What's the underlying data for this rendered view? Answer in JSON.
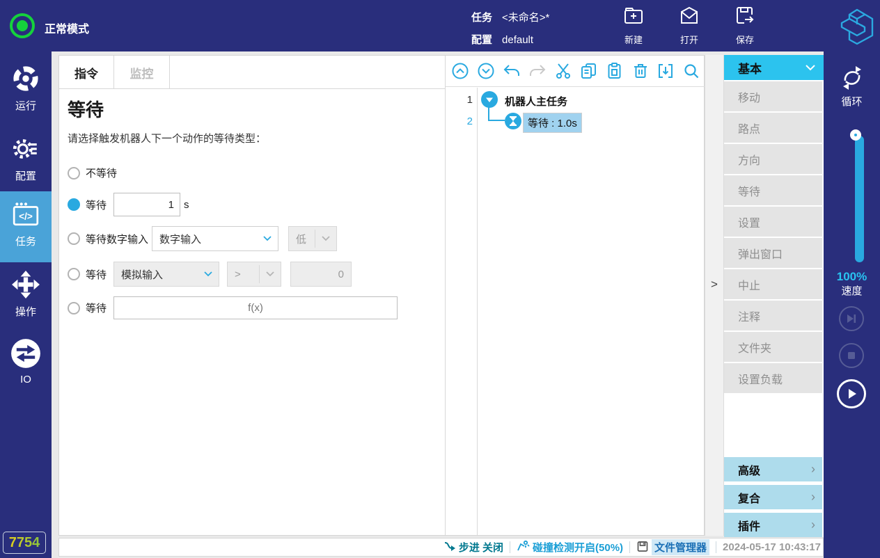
{
  "topbar": {
    "mode": "正常模式",
    "task_label": "任务",
    "task_value": "<未命名>*",
    "config_label": "配置",
    "config_value": "default",
    "new_label": "新建",
    "open_label": "打开",
    "save_label": "保存"
  },
  "left_sidebar": {
    "run": "运行",
    "config": "配置",
    "task": "任务",
    "operate": "操作",
    "io": "IO",
    "badge": "7754"
  },
  "form": {
    "tab_instruction": "指令",
    "tab_monitor": "监控",
    "title": "等待",
    "description": "请选择触发机器人下一个动作的等待类型：",
    "opt_no_wait": "不等待",
    "opt_wait": "等待",
    "wait_seconds": "1",
    "wait_unit": "s",
    "opt_wait_digital": "等待数字输入",
    "digital_source": "数字输入",
    "digital_level": "低",
    "opt_wait_analog": "等待",
    "analog_source": "模拟输入",
    "analog_operator": ">",
    "analog_value": "0",
    "opt_wait_expr": "等待",
    "expr_placeholder": "f(x)"
  },
  "tree": {
    "toolbar_icons": [
      "collapse-all",
      "expand-all",
      "undo",
      "redo",
      "cut",
      "copy",
      "paste",
      "delete",
      "insert",
      "search"
    ],
    "collapse_handle": ">",
    "nodes": [
      {
        "line": "1",
        "label": "机器人主任务"
      },
      {
        "line": "2",
        "label": "等待 : 1.0s"
      }
    ]
  },
  "catalog": {
    "basic_header": "基本",
    "basic_items": [
      "移动",
      "路点",
      "方向",
      "等待",
      "设置",
      "弹出窗口",
      "中止",
      "注释",
      "文件夹",
      "设置负载"
    ],
    "advanced": "高级",
    "composite": "复合",
    "plugin": "插件"
  },
  "right_sidebar": {
    "loop": "循环",
    "speed_value": "100%",
    "speed_label": "速度"
  },
  "statusbar": {
    "step": "步进 关闭",
    "collision": "碰撞检测开启(50%)",
    "file_manager": "文件管理器",
    "timestamp": "2024-05-17 10:43:17"
  },
  "colors": {
    "navy": "#292e7c",
    "accent_blue": "#29a9e0",
    "header_cyan": "#2cc3ee",
    "section_light_blue": "#aedcec",
    "active_nav": "#4aa3d8",
    "tree_highlight": "#a0d2ef",
    "status_green": "#15d23c"
  }
}
